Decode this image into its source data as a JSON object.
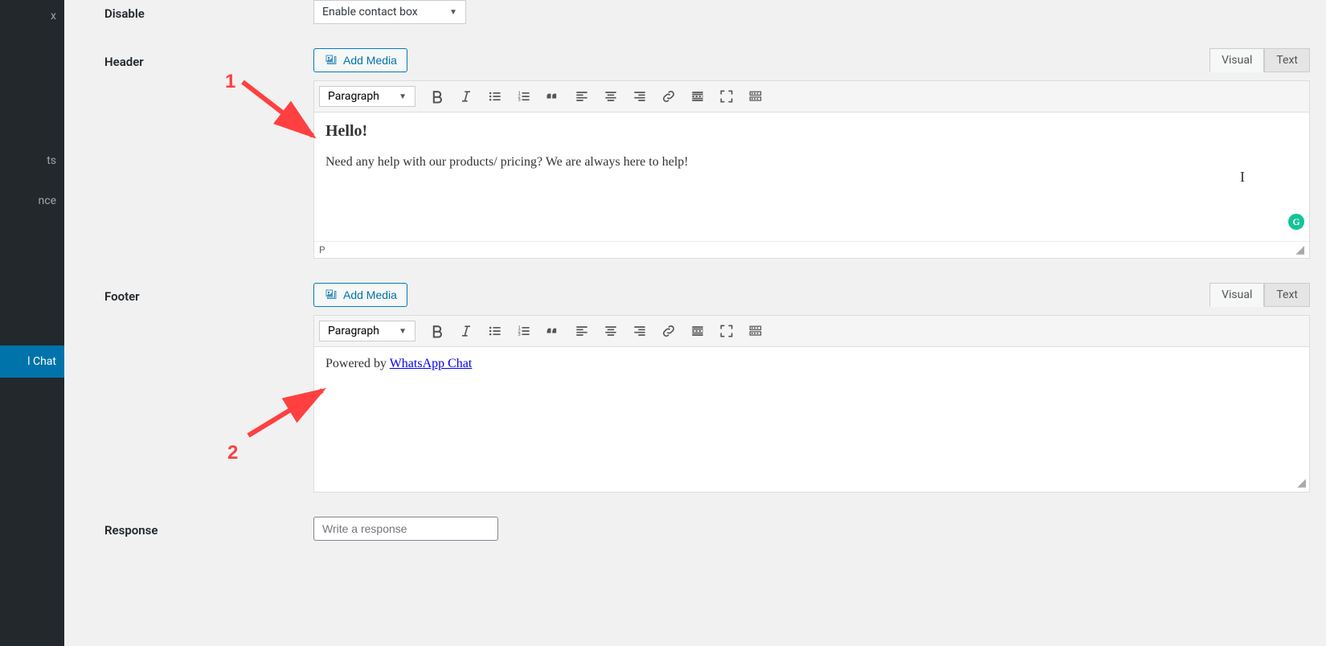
{
  "sidebar": {
    "items": [
      {
        "label": "x"
      },
      {
        "label": "ts"
      },
      {
        "label": "nce"
      },
      {
        "label": "l Chat"
      }
    ]
  },
  "form": {
    "disable": {
      "label": "Disable",
      "select_value": "Enable contact box"
    },
    "header": {
      "label": "Header",
      "add_media": "Add Media",
      "tabs": {
        "visual": "Visual",
        "text": "Text"
      },
      "format": "Paragraph",
      "content_h3": "Hello!",
      "content_p": "Need any help with our products/ pricing? We are always here to help!",
      "status_path": "P"
    },
    "footer": {
      "label": "Footer",
      "add_media": "Add Media",
      "tabs": {
        "visual": "Visual",
        "text": "Text"
      },
      "format": "Paragraph",
      "content_prefix": "Powered by ",
      "content_link": "WhatsApp Chat"
    },
    "response": {
      "label": "Response",
      "placeholder": "Write a response"
    }
  },
  "annotations": {
    "num1": "1",
    "num2": "2"
  },
  "toolbar_icon_names": [
    "bold",
    "italic",
    "bullet-list",
    "numbered-list",
    "blockquote",
    "align-left",
    "align-center",
    "align-right",
    "link",
    "read-more",
    "fullscreen",
    "toolbar-toggle"
  ]
}
